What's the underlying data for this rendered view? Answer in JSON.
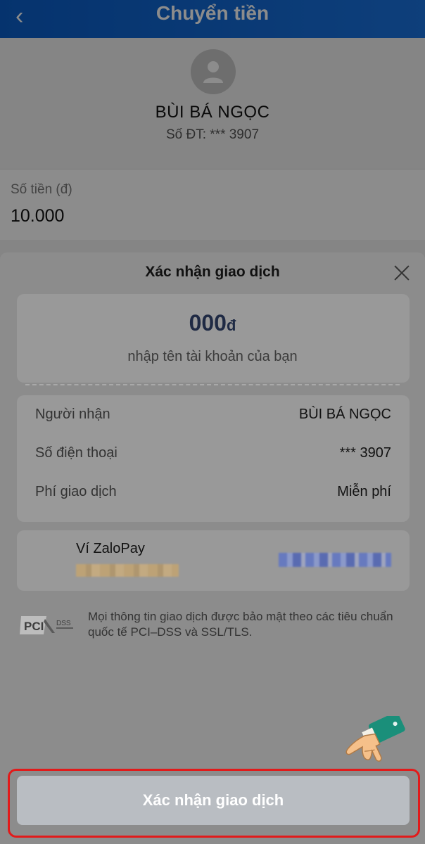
{
  "header": {
    "back_icon": "chevron-left-icon",
    "title": "Chuyển tiền"
  },
  "recipient": {
    "avatar_icon": "user-avatar-icon",
    "name": "BÙI BÁ NGỌC",
    "phone": "Số ĐT: *** 3907"
  },
  "amount_field": {
    "label": "Số tiền (đ)",
    "value": "10.000"
  },
  "sheet": {
    "title": "Xác nhận giao dịch",
    "close_icon": "close-icon",
    "amount_display": "000",
    "currency": "đ",
    "hint": "nhập tên tài khoản của bạn",
    "details": [
      {
        "label": "Người nhận",
        "value": "BÙI BÁ NGỌC"
      },
      {
        "label": "Số điện thoại",
        "value": "*** 3907"
      },
      {
        "label": "Phí giao dịch",
        "value": "Miễn phí"
      }
    ],
    "wallet": {
      "name": "Ví ZaloPay"
    },
    "pci_logo": "pci-dss-logo",
    "security_text": "Mọi thông tin giao dịch được bảo mật theo các tiêu chuẩn quốc tế PCI–DSS và SSL/TLS.",
    "confirm_label": "Xác nhận giao dịch"
  },
  "colors": {
    "header": "#0a5ec9",
    "highlight_outline": "#e21a1a",
    "confirm_button": "#b9bdc2"
  }
}
